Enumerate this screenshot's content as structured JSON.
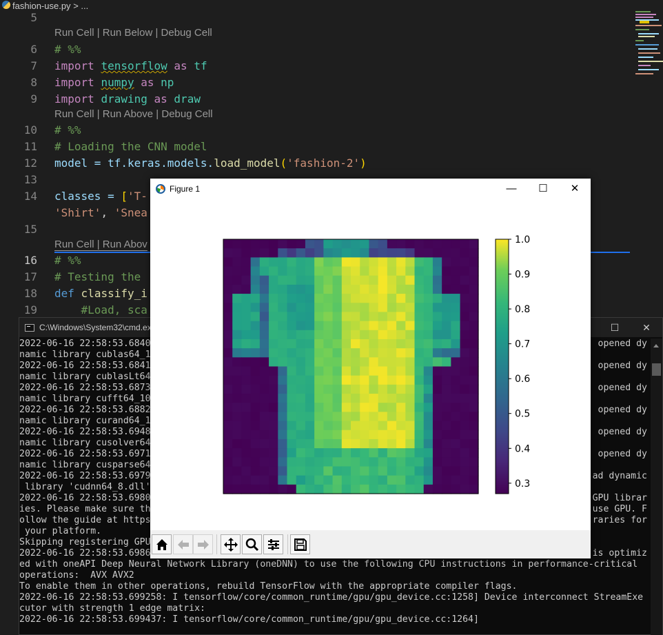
{
  "tab": {
    "filename": "fashion-use.py",
    "breadcrumb": "> ..."
  },
  "editor": {
    "cell_lens": {
      "first": "Run Cell | Run Below | Debug Cell",
      "second": "Run Cell | Run Above | Debug Cell",
      "third": "Run Cell | Run Abov"
    },
    "line_numbers": [
      "5",
      "6",
      "7",
      "8",
      "9",
      "10",
      "11",
      "12",
      "13",
      "14",
      "15",
      "16",
      "17",
      "18",
      "19"
    ],
    "current_line": "16",
    "code": {
      "l6": "# %%",
      "l7_kw": "import",
      "l7_mod": "tensorflow",
      "l7_as": "as",
      "l7_alias": "tf",
      "l8_kw": "import",
      "l8_mod": "numpy",
      "l8_as": "as",
      "l8_alias": "np",
      "l9_kw": "import",
      "l9_mod": "drawing",
      "l9_as": "as",
      "l9_alias": "draw",
      "l10": "# %%",
      "l11": "# Loading the CNN model",
      "l12_a": "model = tf.keras.models.",
      "l12_fn": "load_model",
      "l12_p1": "(",
      "l12_str": "'fashion-2'",
      "l12_p2": ")",
      "l14_a": "classes = ",
      "l14_br": "[",
      "l14_str": "'T-",
      "l14b_s1": "'Shirt'",
      "l14b_comma": ", ",
      "l14b_s2": "'Snea",
      "l16": "# %%",
      "l17": "# Testing the",
      "l18_kw": "def",
      "l18_fn": "classify_i",
      "l19": "#Load, sca"
    }
  },
  "cmd": {
    "title": "C:\\Windows\\System32\\cmd.exe",
    "controls": {
      "minimize": "—",
      "maximize": "☐",
      "close": "✕"
    },
    "lines": [
      "2022-06-16 22:58:53.6840",
      "namic library cublas64_1",
      "2022-06-16 22:58:53.6841",
      "namic library cublasLt64",
      "2022-06-16 22:58:53.6873",
      "namic library cufft64_10",
      "2022-06-16 22:58:53.6882",
      "namic library curand64_1",
      "2022-06-16 22:58:53.6948",
      "namic library cusolver64",
      "2022-06-16 22:58:53.6971",
      "namic library cusparse64",
      "2022-06-16 22:58:53.6979",
      " library 'cudnn64_8.dll'",
      "2022-06-16 22:58:53.6980",
      "ies. Please make sure th",
      "ollow the guide at https",
      " your platform.",
      "Skipping registering GPU",
      "2022-06-16 22:58:53.6986",
      "ed with oneAPI Deep Neural Network Library (oneDNN) to use the following CPU instructions in performance-critical",
      "operations:  AVX AVX2",
      "To enable them in other operations, rebuild TensorFlow with the appropriate compiler flags.",
      "2022-06-16 22:58:53.699258: I tensorflow/core/common_runtime/gpu/gpu_device.cc:1258] Device interconnect StreamExe",
      "cutor with strength 1 edge matrix:",
      "2022-06-16 22:58:53.699437: I tensorflow/core/common_runtime/gpu/gpu_device.cc:1264]"
    ],
    "right_fragments": [
      {
        "row": 0,
        "text": "opened dy"
      },
      {
        "row": 2,
        "text": "opened dy"
      },
      {
        "row": 4,
        "text": "opened dy"
      },
      {
        "row": 6,
        "text": "opened dy"
      },
      {
        "row": 8,
        "text": "opened dy"
      },
      {
        "row": 10,
        "text": "opened dy"
      },
      {
        "row": 12,
        "text": "ad dynamic"
      },
      {
        "row": 14,
        "text": "GPU librar"
      },
      {
        "row": 15,
        "text": "use GPU. F"
      },
      {
        "row": 16,
        "text": "raries for"
      },
      {
        "row": 19,
        "text": "is optimiz"
      }
    ]
  },
  "figure": {
    "title": "Figure 1",
    "controls": {
      "minimize": "—",
      "maximize": "☐",
      "close": "✕"
    },
    "colorbar_ticks": [
      "1.0",
      "0.9",
      "0.8",
      "0.7",
      "0.6",
      "0.5",
      "0.4",
      "0.3"
    ],
    "toolbar": [
      "home-icon",
      "back-icon",
      "forward-icon",
      "pan-icon",
      "zoom-icon",
      "configure-icon",
      "save-icon"
    ]
  },
  "chart_data": {
    "type": "heatmap",
    "colormap": "viridis",
    "clim": [
      0.27,
      1.0
    ],
    "rows": 28,
    "cols": 28,
    "colorbar_ticks": [
      1.0,
      0.9,
      0.8,
      0.7,
      0.6,
      0.5,
      0.4,
      0.3
    ],
    "grid": false
  },
  "colors": {
    "editor_bg": "#1e1e1e",
    "cmd_bg": "#0c0c0c",
    "accent": "#1f6feb"
  }
}
